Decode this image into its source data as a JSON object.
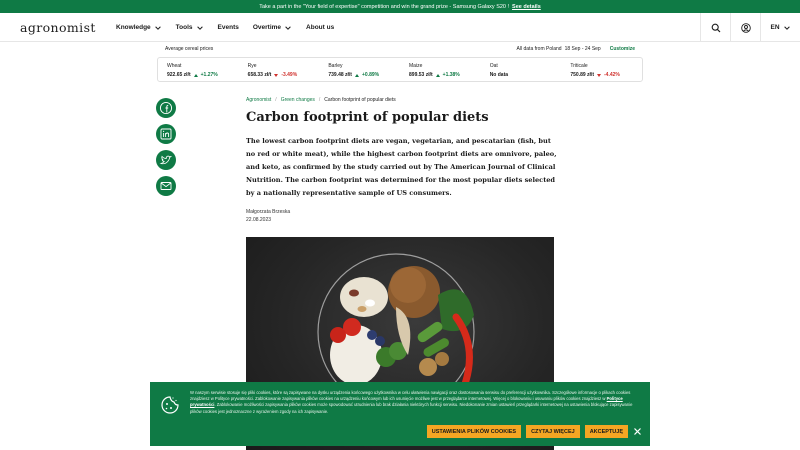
{
  "promo": {
    "text": "Take a part in the \"Your field of expertise\" competition and win the grand prize - Samsung Galaxy S20 !",
    "link": "See details"
  },
  "nav": {
    "logo": "agronomist",
    "menu": [
      {
        "label": "Knowledge",
        "has_dropdown": true
      },
      {
        "label": "Tools",
        "has_dropdown": true
      },
      {
        "label": "Events",
        "has_dropdown": false
      },
      {
        "label": "Overtime",
        "has_dropdown": true
      },
      {
        "label": "About us",
        "has_dropdown": false
      }
    ],
    "language": "EN",
    "icons": [
      "search-icon",
      "user-icon",
      "chevron-down-icon"
    ]
  },
  "prices": {
    "title": "Average cereal prices",
    "data_label": "All data from Poland",
    "date_range": "18 Sep - 24 Sep",
    "customize": "Customize",
    "items": [
      {
        "name": "Wheat",
        "price": "922.65 zł/t",
        "change": "+1.27%",
        "direction": "up"
      },
      {
        "name": "Rye",
        "price": "658.33 zł/t",
        "change": "-3.49%",
        "direction": "down"
      },
      {
        "name": "Barley",
        "price": "739.48 zł/t",
        "change": "+0.89%",
        "direction": "up"
      },
      {
        "name": "Maize",
        "price": "899.53 zł/t",
        "change": "+1.38%",
        "direction": "up"
      },
      {
        "name": "Oat",
        "price": "No data",
        "change": "",
        "direction": "none"
      },
      {
        "name": "Triticale",
        "price": "750.89 zł/t",
        "change": "-4.42%",
        "direction": "down"
      }
    ],
    "colors": {
      "up": "#0f7a45",
      "down": "#d0312d"
    }
  },
  "share": [
    "facebook-icon",
    "linkedin-icon",
    "twitter-icon",
    "email-icon"
  ],
  "breadcrumb": {
    "items": [
      "Agronomist",
      "Green changes",
      "Carbon footprint of popular diets"
    ],
    "separator": "/"
  },
  "article": {
    "title": "Carbon footprint of popular diets",
    "lead": "The lowest carbon footprint diets are vegan, vegetarian, and pescatarian (fish, but no red or white meat), while the highest carbon footprint diets are omnivore, paleo, and keto, as confirmed by the study carried out by The American Journal of Clinical Nutrition. The carbon footprint was determined for the most popular diets selected by a nationally representative sample of US consumers.",
    "author": "Małgorzata Brzeska",
    "date": "22.08.2023"
  },
  "cookie": {
    "text_1": "W naszym serwisie stosuje się pliki cookies, które są zapisywane na dysku urządzenia końcowego użytkownika w celu ułatwienia nawigacji oraz dostosowania serwisu do preferencji użytkownika. Szczegółowe informacje o plikach cookies znajdziesz w Polityce prywatności. Zablokowanie zapisywania plików cookies na urządzeniu końcowym lub ich usunięcie możliwe jest w przeglądarce internetowej. Więcej o blokowaniu i usuwaniu plików cookies znajdziesz w",
    "link": "Polityce prywatności",
    "text_2": ". Zablokowanie możliwości zapisywania plików cookies może spowodować utrudnienia lub brak działania niektórych funkcji serwisu. Niedokonanie zmian ustawień przeglądarki internetowej na ustawienia blokujące zapisywanie plików cookies jest jednoznaczne z wyrażeniem zgody na ich zapisywanie.",
    "buttons": [
      "USTAWIENIA PLIKÓW COOKIES",
      "CZYTAJ WIĘCEJ",
      "AKCEPTUJĘ"
    ],
    "colors": {
      "background": "#0f7a45",
      "button": "#f5a623"
    }
  },
  "colors": {
    "brand": "#0f7a45"
  }
}
